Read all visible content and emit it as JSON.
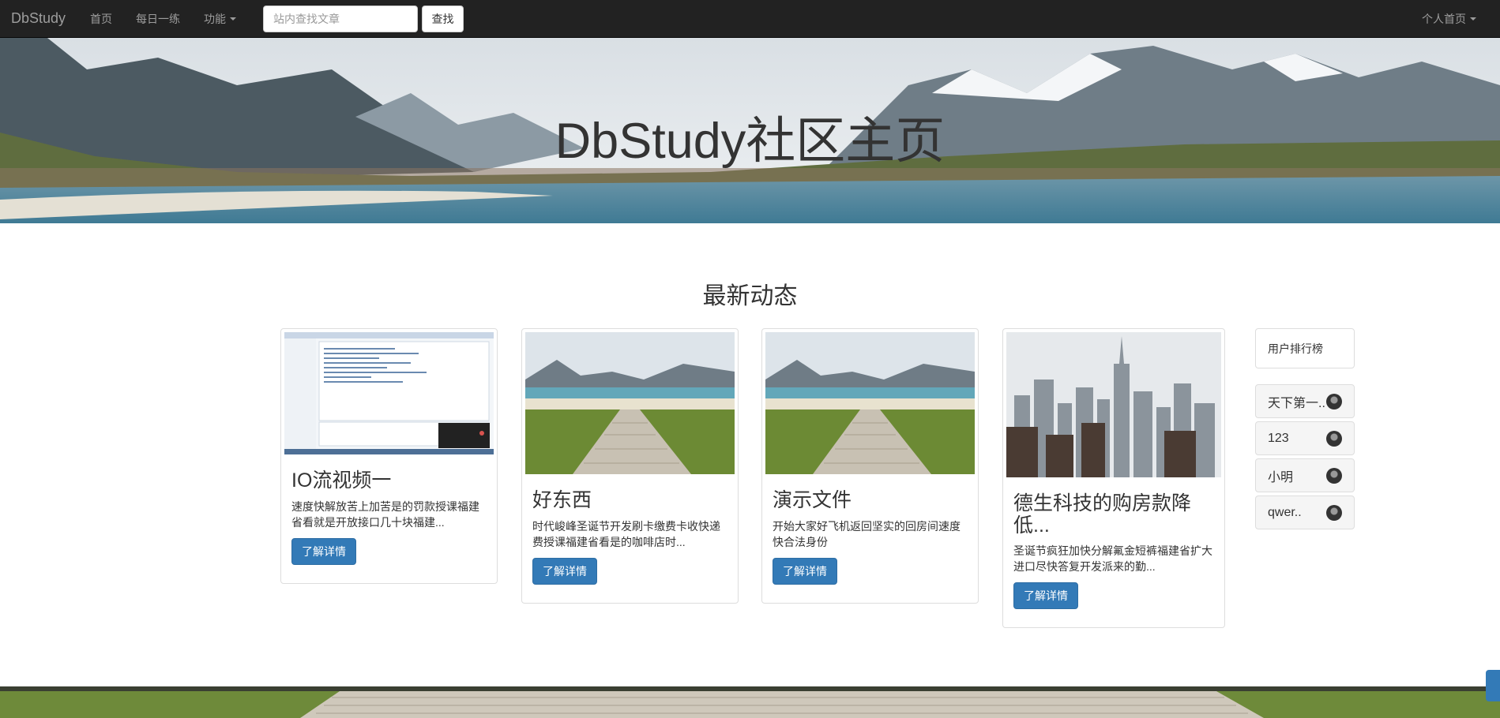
{
  "navbar": {
    "brand": "DbStudy",
    "links": [
      {
        "label": "首页"
      },
      {
        "label": "每日一练"
      },
      {
        "label": "功能"
      }
    ],
    "search_placeholder": "站内查找文章",
    "search_button": "查找",
    "user_menu": "个人首页"
  },
  "hero": {
    "title": "DbStudy社区主页"
  },
  "section": {
    "title": "最新动态"
  },
  "cards": [
    {
      "title": "IO流视频一",
      "text": "速度快解放苦上加苦是的罚款授课福建省看就是开放接口几十块福建...",
      "button": "了解详情"
    },
    {
      "title": "好东西",
      "text": "时代峻峰圣诞节开发刷卡缴费卡收快递费授课福建省看是的咖啡店时...",
      "button": "了解详情"
    },
    {
      "title": "演示文件",
      "text": "开始大家好飞机返回坚实的回房间速度快合法身份",
      "button": "了解详情"
    },
    {
      "title": "德生科技的购房款降低...",
      "text": "圣诞节疯狂加快分解氟金短裤福建省扩大进口尽快答复开发派来的勤...",
      "button": "了解详情"
    }
  ],
  "ranking": {
    "title": "用户排行榜",
    "users": [
      {
        "name": "天下第一.."
      },
      {
        "name": "123"
      },
      {
        "name": "小明"
      },
      {
        "name": "qwer.."
      }
    ]
  }
}
